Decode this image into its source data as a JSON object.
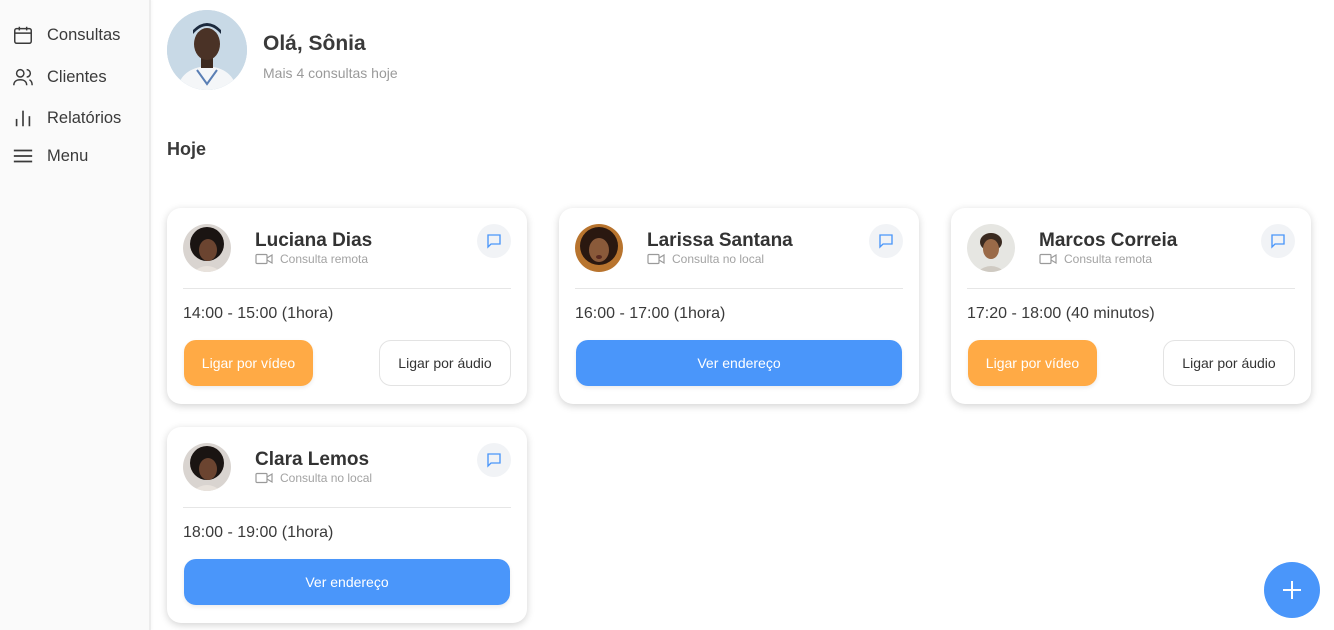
{
  "sidebar": {
    "items": [
      {
        "label": "Consultas",
        "icon": "calendar-icon"
      },
      {
        "label": "Clientes",
        "icon": "users-icon"
      },
      {
        "label": "Relatórios",
        "icon": "bar-chart-icon"
      },
      {
        "label": "Menu",
        "icon": "menu-icon"
      }
    ]
  },
  "header": {
    "greeting": "Olá, Sônia",
    "subtitle": "Mais 4 consultas hoje"
  },
  "section_title": "Hoje",
  "appointments": [
    {
      "name": "Luciana Dias",
      "type": "Consulta remota",
      "time": "14:00 - 15:00 (1hora)",
      "video_label": "Ligar por vídeo",
      "audio_label": "Ligar por áudio"
    },
    {
      "name": "Larissa Santana",
      "type": "Consulta no local",
      "time": "16:00 - 17:00 (1hora)",
      "address_label": "Ver endereço"
    },
    {
      "name": "Marcos Correia",
      "type": "Consulta remota",
      "time": "17:20 - 18:00 (40 minutos)",
      "video_label": "Ligar por vídeo",
      "audio_label": "Ligar por áudio"
    },
    {
      "name": "Clara Lemos",
      "type": "Consulta no local",
      "time": "18:00 - 19:00 (1hora)",
      "address_label": "Ver endereço"
    }
  ],
  "colors": {
    "accent_blue": "#4a96fa",
    "accent_orange": "#ffaa45"
  },
  "fab_icon": "plus-icon"
}
